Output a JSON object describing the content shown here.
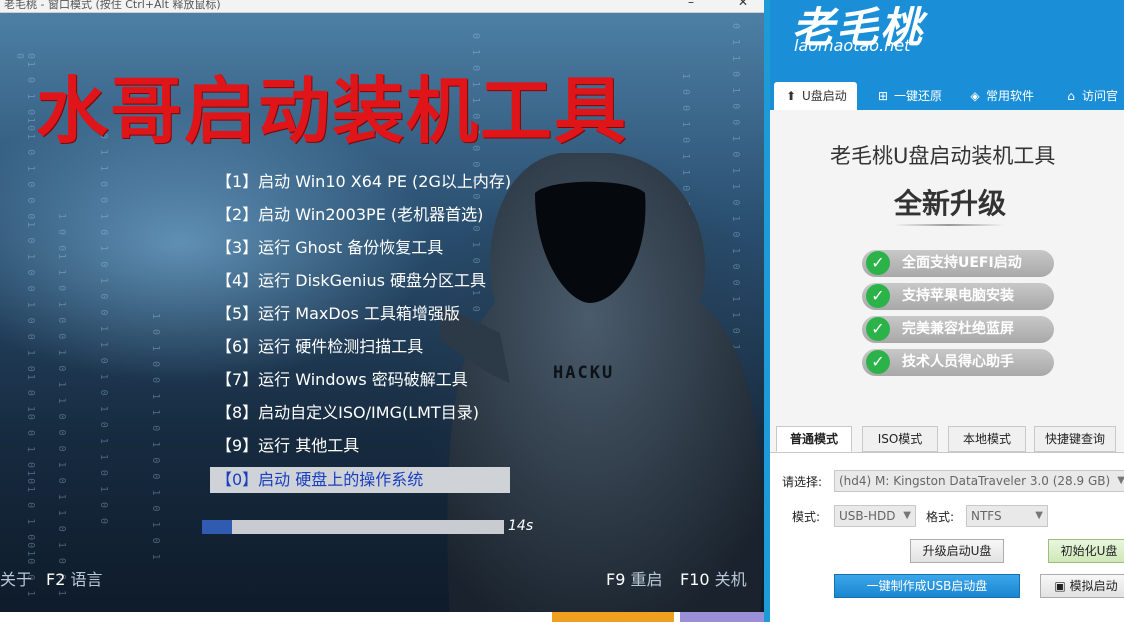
{
  "boot_window": {
    "title": "老毛桃 - 窗口模式 (按住 Ctrl+Alt 释放鼠标)",
    "big_title": "水哥启动装机工具",
    "hood_text": "HACKU",
    "menu": [
      {
        "label": "【1】启动 Win10 X64 PE (2G以上内存)"
      },
      {
        "label": "【2】启动 Win2003PE (老机器首选)"
      },
      {
        "label": "【3】运行 Ghost 备份恢复工具"
      },
      {
        "label": "【4】运行 DiskGenius 硬盘分区工具"
      },
      {
        "label": "【5】运行 MaxDos 工具箱增强版"
      },
      {
        "label": "【6】运行 硬件检测扫描工具"
      },
      {
        "label": "【7】运行 Windows 密码破解工具"
      },
      {
        "label": "【8】启动自定义ISO/IMG(LMT目录)"
      },
      {
        "label": "【9】运行 其他工具"
      },
      {
        "label": "【0】启动 硬盘上的操作系统",
        "selected": true
      }
    ],
    "progress_fraction": 0.1,
    "countdown": "14s",
    "footer_left": [
      {
        "key": "",
        "label": "关于"
      },
      {
        "key": "F2",
        "label": "语言"
      }
    ],
    "footer_right": [
      {
        "key": "F9",
        "label": "重启"
      },
      {
        "key": "F10",
        "label": "关机"
      }
    ],
    "colors": {
      "title_red": "#e0151a",
      "selected_text": "#1a3fbf",
      "accent_blue": "#1a8fd8"
    }
  },
  "app": {
    "logo": "老毛桃",
    "domain": "laomaotao.net",
    "nav": [
      {
        "icon": "usb-icon",
        "label": "U盘启动",
        "active": true
      },
      {
        "icon": "windows-icon",
        "label": "一键还原"
      },
      {
        "icon": "box-icon",
        "label": "常用软件"
      },
      {
        "icon": "home-icon",
        "label": "访问官"
      }
    ],
    "title": "老毛桃U盘启动装机工具",
    "subtitle": "全新升级",
    "features": [
      "全面支持UEFI启动",
      "支持苹果电脑安装",
      "完美兼容杜绝蓝屏",
      "技术人员得心助手"
    ],
    "tabs": [
      {
        "label": "普通模式",
        "active": true
      },
      {
        "label": "ISO模式"
      },
      {
        "label": "本地模式"
      },
      {
        "label": "快捷键查询"
      }
    ],
    "device_label": "请选择:",
    "device_value": "(hd4) M: Kingston DataTraveler 3.0 (28.9 GB)",
    "mode_label": "模式:",
    "mode_value": "USB-HDD",
    "format_label": "格式:",
    "format_value": "NTFS",
    "upgrade_button": "升级启动U盘",
    "init_button": "初始化U盘",
    "make_button": "一键制作成USB启动盘",
    "simulate_button": "模拟启动"
  }
}
